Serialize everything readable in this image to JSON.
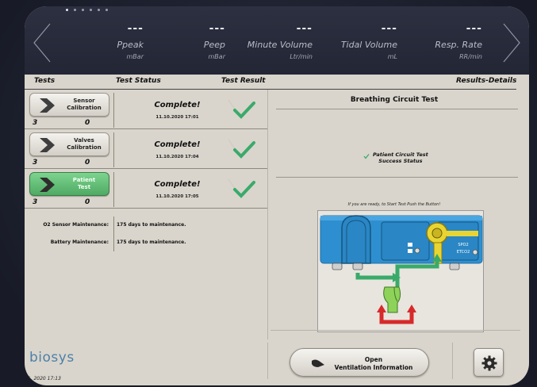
{
  "metrics": [
    {
      "value": "---",
      "label": "Ppeak",
      "unit": "mBar"
    },
    {
      "value": "---",
      "label": "Peep",
      "unit": "mBar"
    },
    {
      "value": "---",
      "label": "Minute Volume",
      "unit": "Ltr/min"
    },
    {
      "value": "---",
      "label": "Tidal Volume",
      "unit": "mL"
    },
    {
      "value": "---",
      "label": "Resp. Rate",
      "unit": "RR/min"
    }
  ],
  "headers": {
    "tests": "Tests",
    "status": "Test Status",
    "result": "Test Result",
    "details": "Results-Details"
  },
  "tests": [
    {
      "label_line1": "Sensor",
      "label_line2": "Calibration",
      "count_a": "3",
      "count_b": "0",
      "status": "Complete!",
      "time": "11.10.2020 17:01"
    },
    {
      "label_line1": "Valves",
      "label_line2": "Calibration",
      "count_a": "3",
      "count_b": "0",
      "status": "Complete!",
      "time": "11.10.2020 17:04"
    },
    {
      "label_line1": "Patient",
      "label_line2": "Test",
      "count_a": "3",
      "count_b": "0",
      "status": "Complete!",
      "time": "11.10.2020 17:05"
    }
  ],
  "maintenance": [
    {
      "key": "O2 Sensor Maintenance:",
      "value": "175 days to maintenance."
    },
    {
      "key": "Battery Maintenance:",
      "value": "175 days to maintenance."
    }
  ],
  "details": {
    "title": "Breathing Circuit Test",
    "success_line1": "Patient Circuit Test",
    "success_line2": "Success Status",
    "ready_text": "If you are ready, to Start Test Push the Button!",
    "device_label_1": "SPO2",
    "device_label_2": "ETCO2"
  },
  "footer": {
    "logo": "biosys",
    "datetime": "11. 2020  17:13",
    "open_line1": "Open",
    "open_line2": "Ventilation Information"
  },
  "colors": {
    "accent_green": "#3aaa6a",
    "button_green": "#5fbf73",
    "logo_blue": "#4e7fa8",
    "device_blue": "#2e8fd0"
  }
}
